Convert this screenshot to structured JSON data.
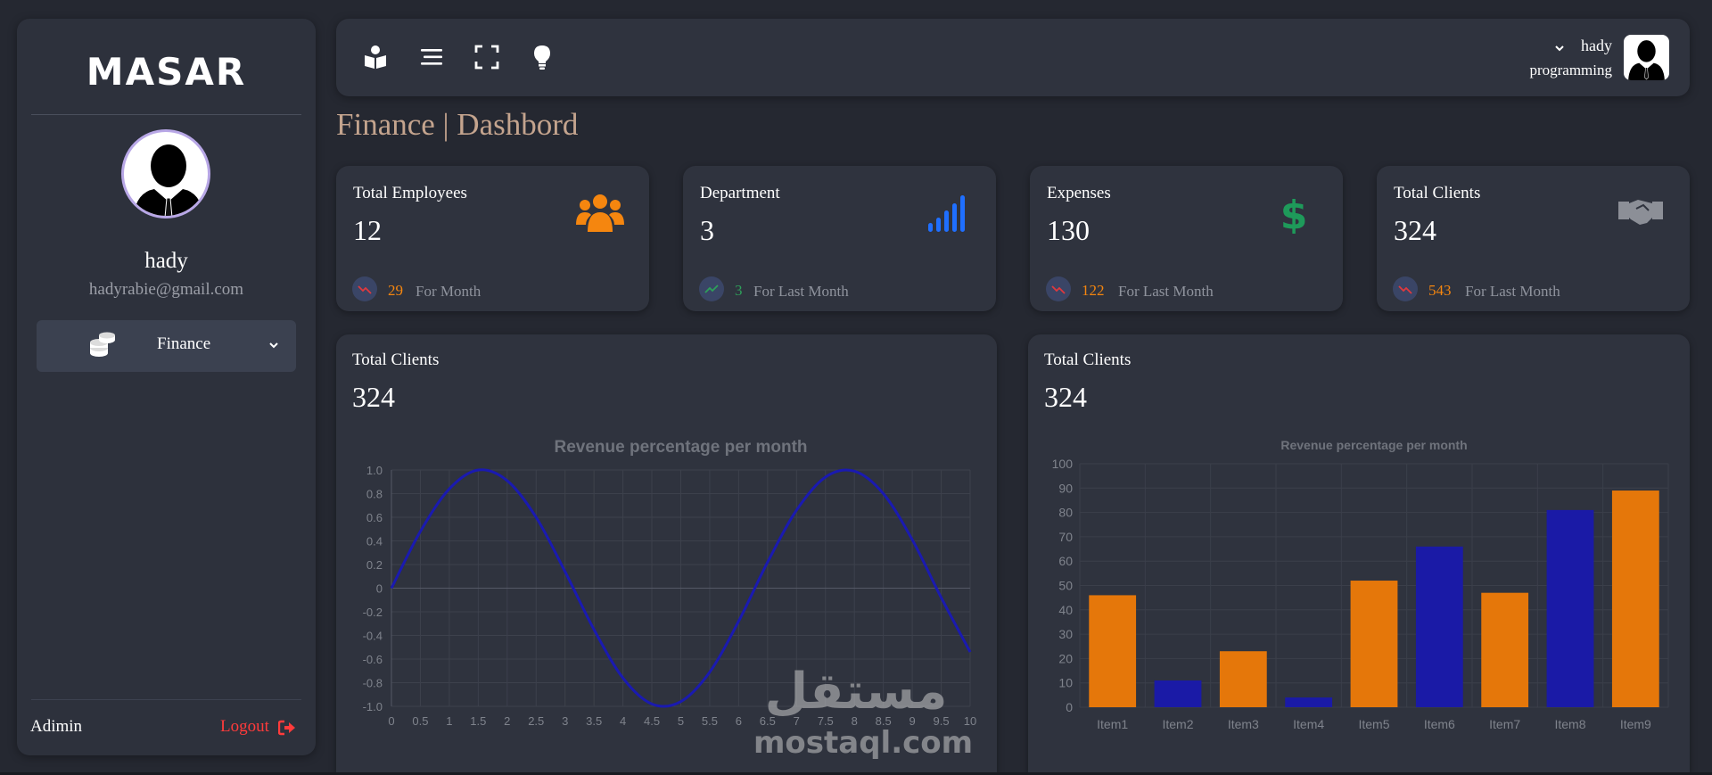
{
  "sidebar": {
    "logo": "MASAR",
    "profile": {
      "name": "hady",
      "email": "hadyrabie@gmail.com"
    },
    "nav": [
      {
        "label": "Finance",
        "icon": "coins-icon"
      }
    ],
    "footer": {
      "user": "Adimin",
      "logout": "Logout"
    }
  },
  "topbar": {
    "icons": [
      "book-reader-icon",
      "menu-icon",
      "fullscreen-icon",
      "lightbulb-icon"
    ],
    "user": {
      "name": "hady",
      "role": "programming"
    }
  },
  "page": {
    "title": "Finance | Dashbord"
  },
  "stats": [
    {
      "title": "Total Employees",
      "value": "12",
      "delta": "29",
      "period": "For Month",
      "trend": "down",
      "icon": "users-icon",
      "icon_color": "#f5860f",
      "delta_color": "#f5860f"
    },
    {
      "title": "Department",
      "value": "3",
      "delta": "3",
      "period": "For Last Month",
      "trend": "up",
      "icon": "signal-bars-icon",
      "icon_color": "#1f6fff",
      "delta_color": "#2ea05a"
    },
    {
      "title": "Expenses",
      "value": "130",
      "delta": "122",
      "period": "For Last Month",
      "trend": "down",
      "icon": "dollar-icon",
      "icon_color": "#1e9a5a",
      "delta_color": "#f5860f"
    },
    {
      "title": "Total Clients",
      "value": "324",
      "delta": "543",
      "period": "For Last Month",
      "trend": "down",
      "icon": "handshake-icon",
      "icon_color": "#8c8f97",
      "delta_color": "#f5860f"
    }
  ],
  "charts": [
    {
      "title": "Total Clients",
      "value": "324"
    },
    {
      "title": "Total Clients",
      "value": "324"
    }
  ],
  "watermark": {
    "arabic": "مستقل",
    "latin": "mostaql.com"
  },
  "chart_data": [
    {
      "type": "line",
      "title": "Revenue percentage per month",
      "x": [
        0,
        0.5,
        1,
        1.5,
        2,
        2.5,
        3,
        3.5,
        4,
        4.5,
        5,
        5.5,
        6,
        6.5,
        7,
        7.5,
        8,
        8.5,
        9,
        9.5,
        10
      ],
      "xlim": [
        0,
        10
      ],
      "ylim": [
        -1.0,
        1.0
      ],
      "yticks": [
        "1.0",
        "0.8",
        "0.6",
        "0.4",
        "0.2",
        "0",
        "-0.2",
        "-0.4",
        "-0.6",
        "-0.8",
        "-1.0"
      ],
      "xticks": [
        "0",
        "0.5",
        "1",
        "1.5",
        "2",
        "2.5",
        "3",
        "3.5",
        "4",
        "4.5",
        "5",
        "5.5",
        "6",
        "6.5",
        "7",
        "7.5",
        "8",
        "8.5",
        "9",
        "9.5",
        "10"
      ],
      "series": [
        {
          "values": [
            0,
            0.48,
            0.84,
            1.0,
            0.91,
            0.6,
            0.14,
            -0.35,
            -0.76,
            -0.98,
            -0.96,
            -0.71,
            -0.28,
            0.22,
            0.66,
            0.94,
            0.99,
            0.8,
            0.41,
            -0.08,
            -0.54
          ],
          "color": "#1a1ab0"
        }
      ],
      "grid": true
    },
    {
      "type": "bar",
      "title": "Revenue percentage per month",
      "categories": [
        "Item1",
        "Item2",
        "Item3",
        "Item4",
        "Item5",
        "Item6",
        "Item7",
        "Item8",
        "Item9"
      ],
      "values": [
        46,
        11,
        23,
        4,
        52,
        66,
        47,
        81,
        89
      ],
      "colors": [
        "#e5770a",
        "#1a1aa6",
        "#e5770a",
        "#1a1aa6",
        "#e5770a",
        "#1a1aa6",
        "#e5770a",
        "#1a1aa6",
        "#e5770a"
      ],
      "ylim": [
        0,
        100
      ],
      "yticks": [
        "100",
        "90",
        "80",
        "70",
        "60",
        "50",
        "40",
        "30",
        "20",
        "10",
        "0"
      ],
      "grid": true
    }
  ]
}
